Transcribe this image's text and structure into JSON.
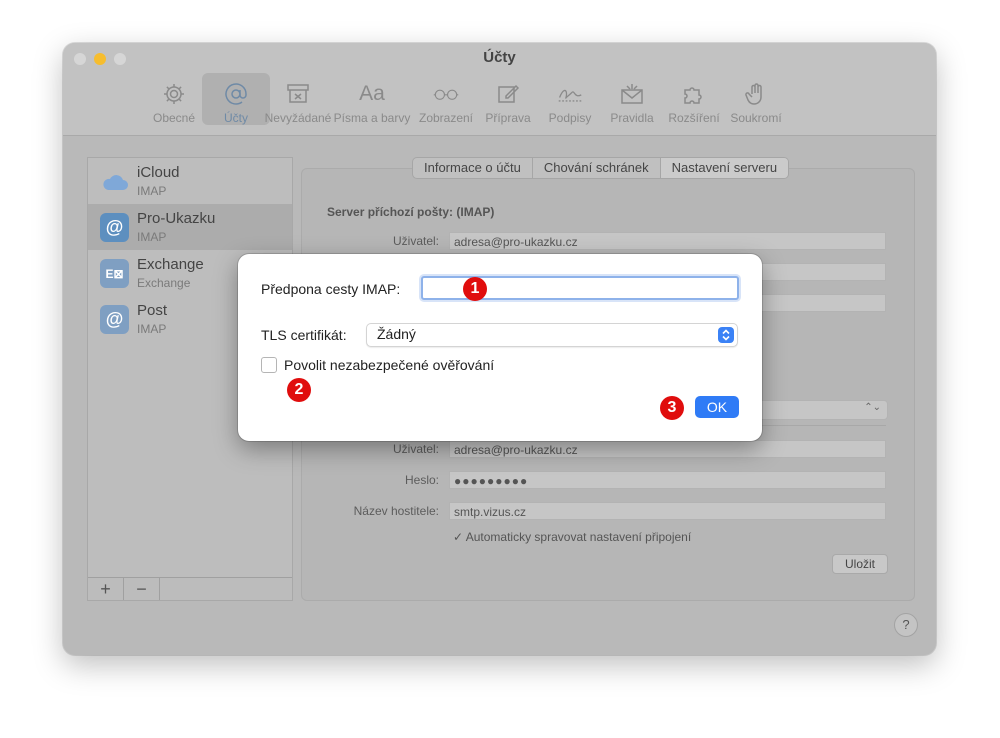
{
  "window": {
    "title": "Účty"
  },
  "toolbar": {
    "items": [
      {
        "label": "Obecné",
        "icon": "gear-icon"
      },
      {
        "label": "Účty",
        "icon": "at-sign-icon",
        "active": true
      },
      {
        "label": "Nevyžádané",
        "icon": "junk-tray-icon"
      },
      {
        "label": "Písma a barvy",
        "icon": "fonts-icon"
      },
      {
        "label": "Zobrazení",
        "icon": "glasses-icon"
      },
      {
        "label": "Příprava",
        "icon": "compose-icon"
      },
      {
        "label": "Podpisy",
        "icon": "signature-icon"
      },
      {
        "label": "Pravidla",
        "icon": "rules-envelope-icon"
      },
      {
        "label": "Rozšíření",
        "icon": "puzzle-icon"
      },
      {
        "label": "Soukromí",
        "icon": "hand-icon"
      }
    ]
  },
  "sidebar": {
    "accounts": [
      {
        "name": "iCloud",
        "type": "IMAP",
        "icon": "cloud-icon"
      },
      {
        "name": "Pro-Ukazku",
        "type": "IMAP",
        "icon": "at-sign-icon",
        "selected": true
      },
      {
        "name": "Exchange",
        "type": "Exchange",
        "icon": "exchange-icon"
      },
      {
        "name": "Post",
        "type": "IMAP",
        "icon": "at-sign-icon"
      }
    ],
    "add_label": "+",
    "remove_label": "−"
  },
  "tabs": [
    "Informace o účtu",
    "Chování schránek",
    "Nastavení serveru"
  ],
  "incoming": {
    "section_title": "Server příchozí pošty: (IMAP)",
    "user_label": "Uživatel:",
    "user_value": "adresa@pro-ukazku.cz"
  },
  "outgoing": {
    "user_label": "Uživatel:",
    "user_value": "adresa@pro-ukazku.cz",
    "password_label": "Heslo:",
    "password_value": "●●●●●●●●●",
    "host_label": "Název hostitele:",
    "host_value": "smtp.vizus.cz",
    "auto_manage_check": "✓",
    "auto_manage_label": "Automaticky spravovat nastavení připojení"
  },
  "save_label": "Uložit",
  "help_label": "?",
  "dialog": {
    "prefix_label": "Předpona cesty IMAP:",
    "prefix_value": "",
    "tls_label": "TLS certifikát:",
    "tls_value": "Žádný",
    "insecure_auth_label": "Povolit nezabezpečené ověřování",
    "insecure_auth_checked": false,
    "ok_label": "OK"
  },
  "annotations": {
    "badge1": "1",
    "badge2": "2",
    "badge3": "3",
    "color": "#e00d0d"
  }
}
